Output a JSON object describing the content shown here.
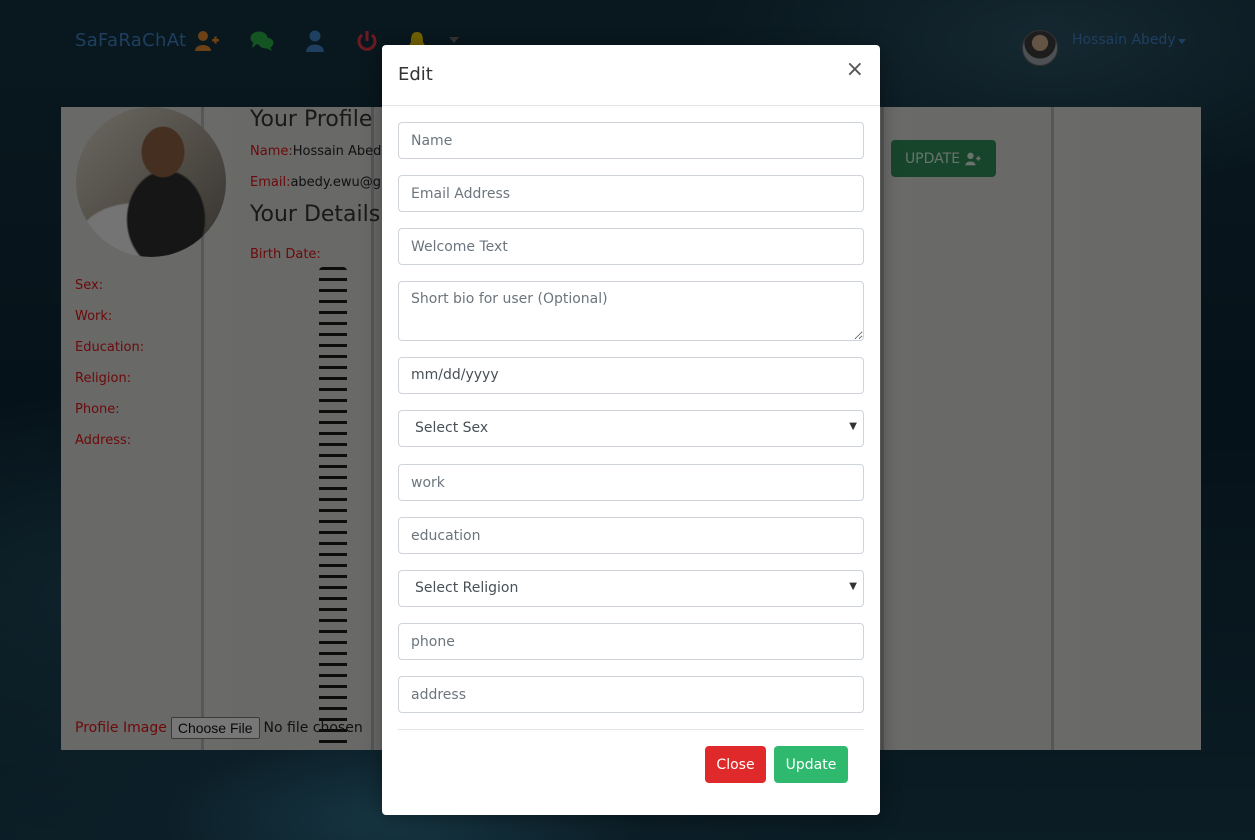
{
  "navbar": {
    "brand": "SaFaRaChAt",
    "username": "Hossain Abedy",
    "icons": [
      "add-user-icon",
      "chat-icon",
      "user-icon",
      "power-icon",
      "bell-icon"
    ],
    "icon_colors": {
      "add_user": "#d9822b",
      "chat": "#28a745",
      "user": "#3d7fc0",
      "power": "#dc3545",
      "bell": "#e0c000"
    }
  },
  "profile": {
    "heading_profile": "Your Profile",
    "name_label": "Name:",
    "name_value": "Hossain Abed",
    "email_label": "Email:",
    "email_value": "abedy.ewu@g",
    "heading_details": "Your Details",
    "birth_label": "Birth Date:",
    "sex_label": "Sex:",
    "work_label": "Work:",
    "education_label": "Education:",
    "religion_label": "Religion:",
    "phone_label": "Phone:",
    "address_label": "Address:",
    "update_label": "UPDATE",
    "image_label": "Profile Image",
    "file_button": "Choose File",
    "file_status": "No file chosen"
  },
  "modal": {
    "title": "Edit",
    "close_symbol": "×",
    "fields": {
      "name_placeholder": "Name",
      "email_placeholder": "Email Address",
      "welcome_placeholder": "Welcome Text",
      "bio_placeholder": "Short bio for user (Optional)",
      "date_value": "mm/dd/yyyy",
      "sex_selected": "Select Sex",
      "work_placeholder": "work",
      "education_placeholder": "education",
      "religion_selected": "Select Religion",
      "phone_placeholder": "phone",
      "address_placeholder": "address"
    },
    "close_button": "Close",
    "update_button": "Update",
    "colors": {
      "close": "#e0292a",
      "update": "#2fb96e"
    }
  }
}
